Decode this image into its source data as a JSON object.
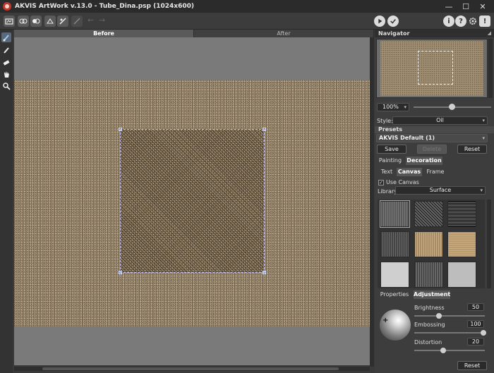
{
  "window": {
    "title": "AKVIS ArtWork v.13.0 - Tube_Dina.psp (1024x600)"
  },
  "window_controls": {
    "minimize": "—",
    "maximize": "☐",
    "close": "✕"
  },
  "toolbar": {
    "icons": [
      "open-image-icon",
      "save-image-icon",
      "print-icon",
      "share-icon",
      "batch-icon",
      "preferences-icon",
      "undo-icon",
      "redo-icon",
      "run-icon",
      "apply-icon",
      "info-icon",
      "help-icon",
      "settings-icon",
      "notification-icon"
    ],
    "undo": "←",
    "redo": "→"
  },
  "view_tabs": {
    "before": "Before",
    "after": "After"
  },
  "navigator": {
    "title": "Navigator",
    "corner": "◢"
  },
  "zoom": {
    "value": "100%",
    "arrow": "▾",
    "level": 0.5
  },
  "style": {
    "label": "Style:",
    "value": "Oil",
    "arrow": "▾"
  },
  "presets": {
    "title": "Presets",
    "selected": "AKVIS Default (1)",
    "arrow": "▾",
    "save": "Save",
    "delete": "Delete",
    "reset": "Reset"
  },
  "main_tabs": [
    "Painting",
    "Decoration"
  ],
  "sub_tabs": [
    "Text",
    "Canvas",
    "Frame"
  ],
  "use_canvas": {
    "label": "Use Canvas",
    "check": "✓",
    "checked": true
  },
  "library": {
    "label": "Library",
    "value": "Surface",
    "arrow": "▾"
  },
  "texture_swatches": [
    "gray-rough",
    "dark-knit",
    "black-white-weave",
    "gray-stripes",
    "beige-vertical",
    "tan-weave",
    "light-gray",
    "dark-gray-stripes",
    "silver-gray"
  ],
  "prop_tabs": [
    "Properties",
    "Adjustment"
  ],
  "sliders": [
    {
      "label": "Brightness",
      "value": "50"
    },
    {
      "label": "Embossing",
      "value": "100"
    },
    {
      "label": "Distortion",
      "value": "20"
    }
  ],
  "bottom": {
    "reset": "Reset"
  }
}
